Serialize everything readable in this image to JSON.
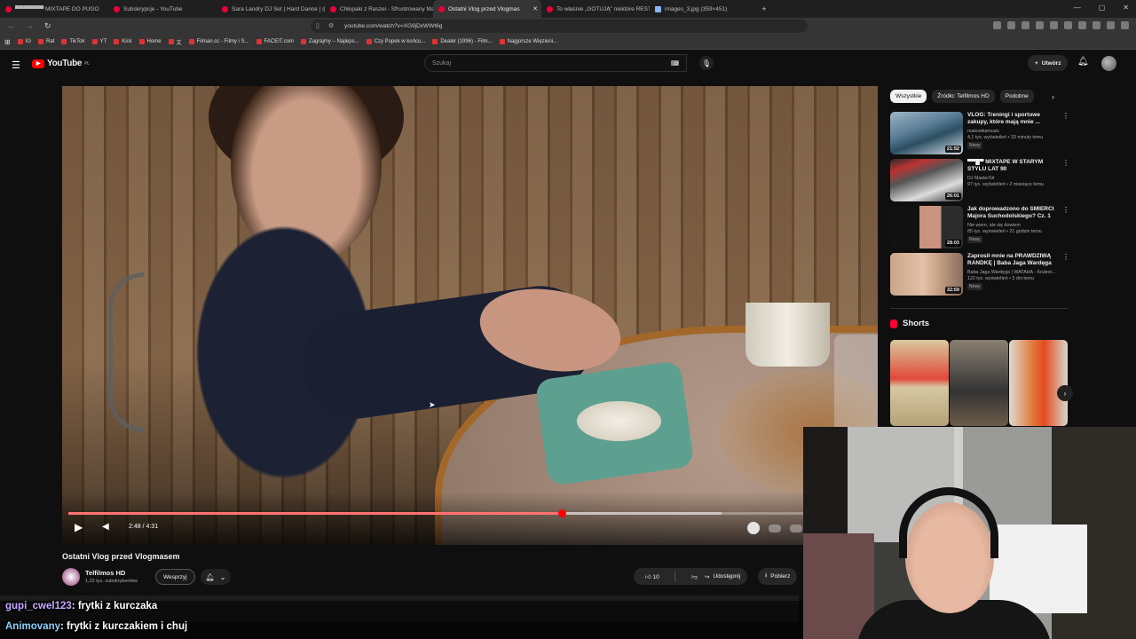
{
  "browser": {
    "tabs": [
      {
        "title": "▀▀▀▀▀▀▀ MIXTAPE DO PUGO",
        "active": false,
        "favicon": "youtube"
      },
      {
        "title": "Subskrypcje - YouTube",
        "active": false,
        "favicon": "youtube"
      },
      {
        "title": "Sara Landry DJ Set | Hard Dance | @",
        "active": false,
        "favicon": "youtube"
      },
      {
        "title": "Chłopaki z Raszei - Sfrustrowany Ma",
        "active": false,
        "favicon": "youtube"
      },
      {
        "title": "Ostatni Vlog przed Vlogmas",
        "active": true,
        "favicon": "youtube"
      },
      {
        "title": "To właśnie „GOTUJĄ” niektóre RESTA",
        "active": false,
        "favicon": "youtube"
      },
      {
        "title": "images_3.jpg (359×451)",
        "active": false,
        "favicon": "image"
      }
    ],
    "url": "youtube.com/watch?v=XG9jDxWWt6g",
    "bookmarks": [
      "IG",
      "Rat",
      "TikTok",
      "YT",
      "Kick",
      "Home",
      "文",
      "Filman.cc - Filmy i S...",
      "FACEIT.com",
      "Zagrajmy – Najleps...",
      "Czy Popek w końcu...",
      "Dealer (1996) - Film...",
      "Najgorsze Więzieni..."
    ]
  },
  "youtube": {
    "logo": "YouTube",
    "logo_region": "PL",
    "search_placeholder": "Szukaj",
    "create_label": "Utwórz"
  },
  "video": {
    "title": "Ostatni Vlog przed Vlogmasem",
    "time": "2:48 / 4:31",
    "progress": 0.62,
    "buffered": 0.82,
    "channel": "Telfilmos HD",
    "subscribers": "1,22 tys. subskrybentów",
    "sponsor_label": "Wesprzyj",
    "likes": "10",
    "dislikes": "0",
    "share_label": "Udostępnij",
    "download_label": "Pobierz"
  },
  "filters": [
    "Wszystkie",
    "Źródło: Telfilmos HD",
    "Podobne"
  ],
  "recommendations": [
    {
      "title": "VLOG: Treningi i sportowe zakupy, które mają mnie ...",
      "channel": "makowkamusic",
      "meta": "4,1 tys. wyświetleń • 33 minuty temu",
      "badge": "Nowy",
      "duration": "21:52"
    },
    {
      "title": "▀▀█▀ MIXTAPE W STARYM STYLU LAT 90",
      "channel": "DJ MasterSit",
      "meta": "97 tys. wyświetleń • 2 miesiące temu",
      "badge": "",
      "duration": "26:01"
    },
    {
      "title": "Jak doprowadzono do ŚMIERCI Majora Suchodolskiego? Cz. 1",
      "channel": "Nie wiem, ale się dowiem",
      "meta": "85 tys. wyświetleń • 21 godzin temu",
      "badge": "Nowy",
      "duration": "28:03"
    },
    {
      "title": "Zaprosił mnie na PRAWDZIWĄ RANDKĘ | Baba Jaga Wardęga",
      "channel": "Baba Jaga Wardęga | WATAHA - Krulest...",
      "meta": "122 tys. wyświetleń • 3 dni temu",
      "badge": "Nowy",
      "duration": "32:59"
    }
  ],
  "shorts_heading": "Shorts",
  "chat": [
    {
      "user": "gupi_cwel123",
      "message": "frytki z kurczaka"
    },
    {
      "user": "Animovany",
      "message": "frytki z kurczakiem i chuj"
    }
  ],
  "colors": {
    "accent": "#ff0000",
    "background": "#0f0f0f"
  }
}
